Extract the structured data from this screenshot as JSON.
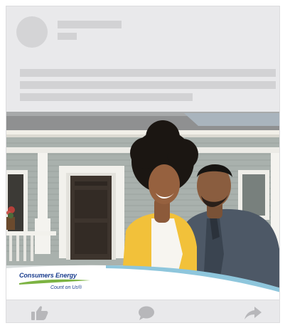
{
  "post": {
    "header": {
      "avatar": "placeholder-avatar",
      "name_placeholder": "",
      "meta_placeholder": ""
    },
    "body_placeholder_lines": 3
  },
  "ad": {
    "brand_name": "Consumers Energy",
    "tagline": "Count on Us®",
    "colors": {
      "brand_blue": "#1c3f8f",
      "brand_green": "#7cb342",
      "band_light_blue": "#8ec6dc"
    }
  },
  "actions": [
    {
      "name": "like",
      "icon": "thumbs-up-icon"
    },
    {
      "name": "comment",
      "icon": "speech-bubble-icon"
    },
    {
      "name": "share",
      "icon": "share-arrow-icon"
    }
  ],
  "colors": {
    "card_background": "#e9e9eb",
    "skeleton": "#d2d2d4",
    "action_icon": "#b7b7ba"
  }
}
